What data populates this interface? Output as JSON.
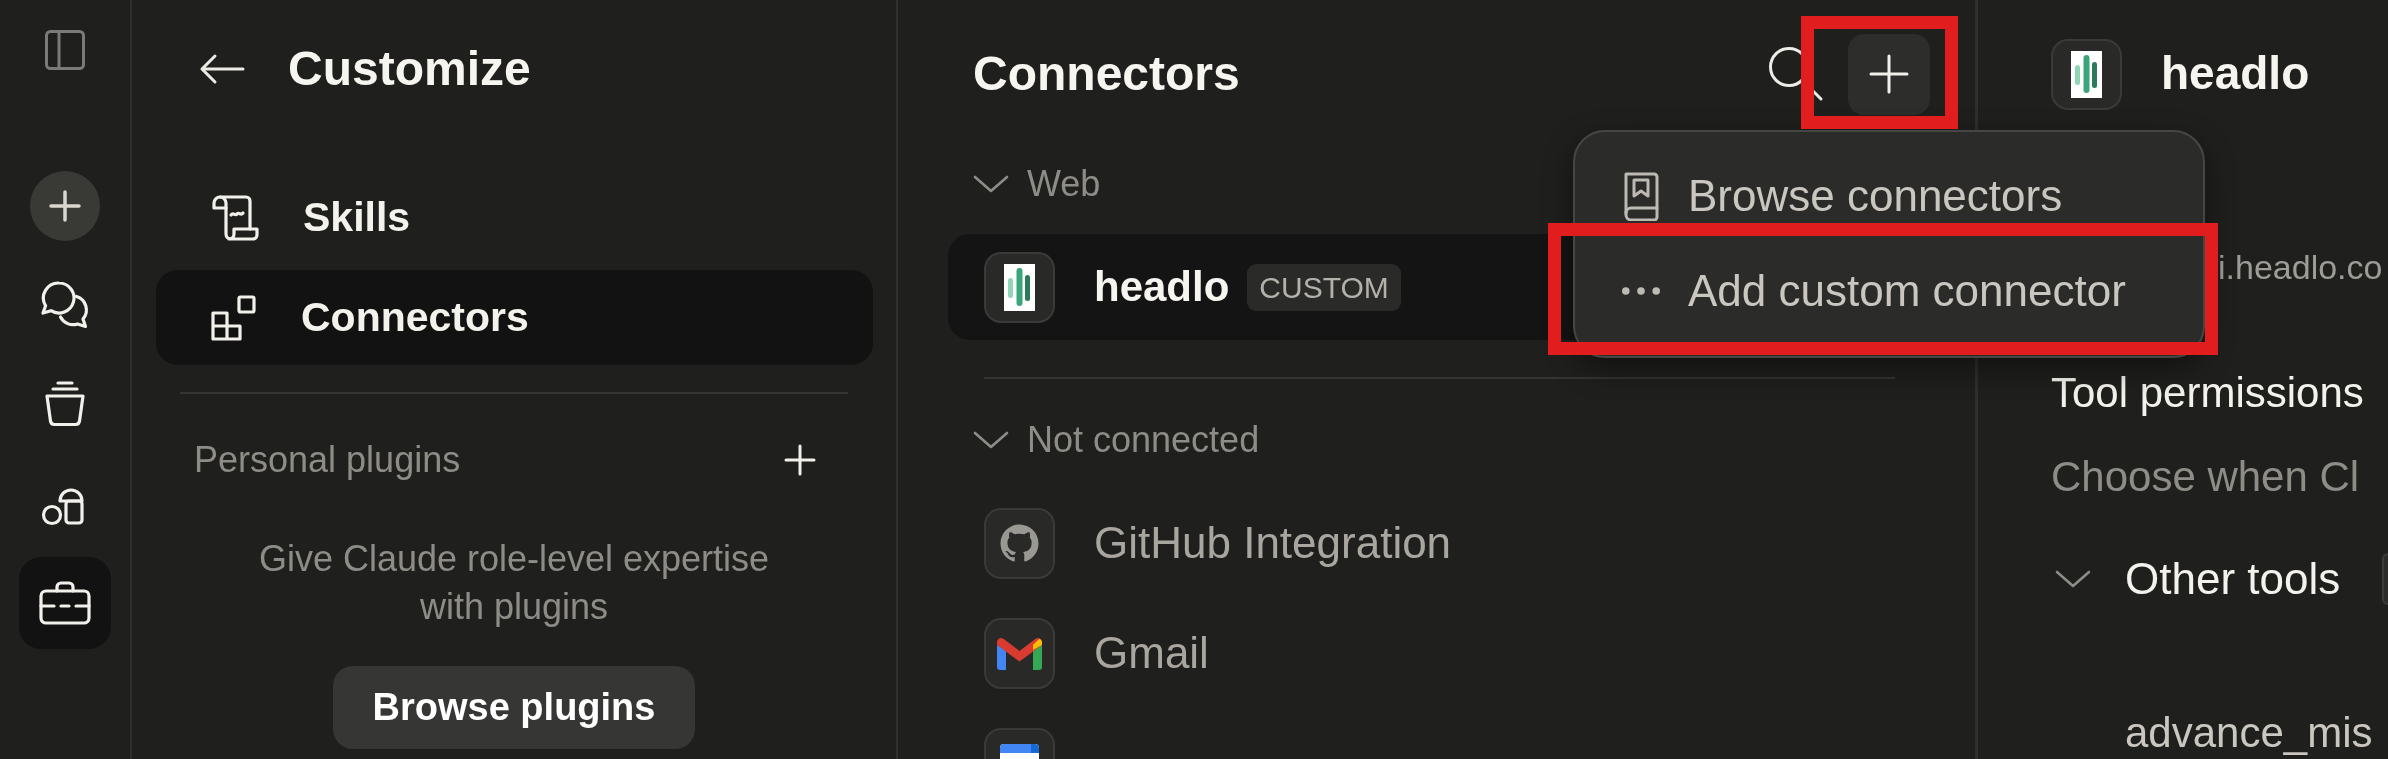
{
  "rail": {
    "items": [
      {
        "kind": "panel",
        "selected": false
      },
      {
        "kind": "plus",
        "selected": false
      },
      {
        "kind": "chat",
        "selected": false
      },
      {
        "kind": "stack",
        "selected": false
      },
      {
        "kind": "shapes",
        "selected": false
      },
      {
        "kind": "briefcase",
        "selected": true
      }
    ]
  },
  "customize": {
    "title": "Customize",
    "nav": [
      {
        "label": "Skills",
        "kind": "scroll",
        "selected": false
      },
      {
        "label": "Connectors",
        "kind": "blocks",
        "selected": true
      }
    ],
    "plugins": {
      "heading": "Personal plugins",
      "description": "Give Claude role-level expertise with plugins",
      "button": "Browse plugins"
    }
  },
  "connectors": {
    "title": "Connectors",
    "add_button": {
      "annotated": true
    },
    "sections": [
      {
        "label": "Web",
        "expanded": true,
        "items": [
          {
            "name": "headlo",
            "badge": "CUSTOM",
            "kind": "bars",
            "connected": true,
            "selected": true
          }
        ]
      },
      {
        "label": "Not connected",
        "expanded": true,
        "items": [
          {
            "name": "GitHub Integration",
            "kind": "github",
            "connected": false,
            "selected": false
          },
          {
            "name": "Gmail",
            "kind": "gmail",
            "connected": false,
            "selected": false
          },
          {
            "kind": "calendar",
            "selected": false
          }
        ]
      }
    ]
  },
  "menu": {
    "items": [
      {
        "label": "Browse connectors",
        "kind": "book",
        "annotated": false
      },
      {
        "label": "Add custom connector",
        "kind": "dots",
        "annotated": true
      }
    ]
  },
  "detail": {
    "name": "headlo",
    "kind": "bars",
    "url": "i.headlo.co",
    "permissions": {
      "heading": "Tool permissions",
      "description": "Choose when Cl",
      "groups": [
        {
          "label": "Other tools",
          "expanded": true,
          "tools": [
            "advance_mis"
          ]
        }
      ]
    }
  }
}
